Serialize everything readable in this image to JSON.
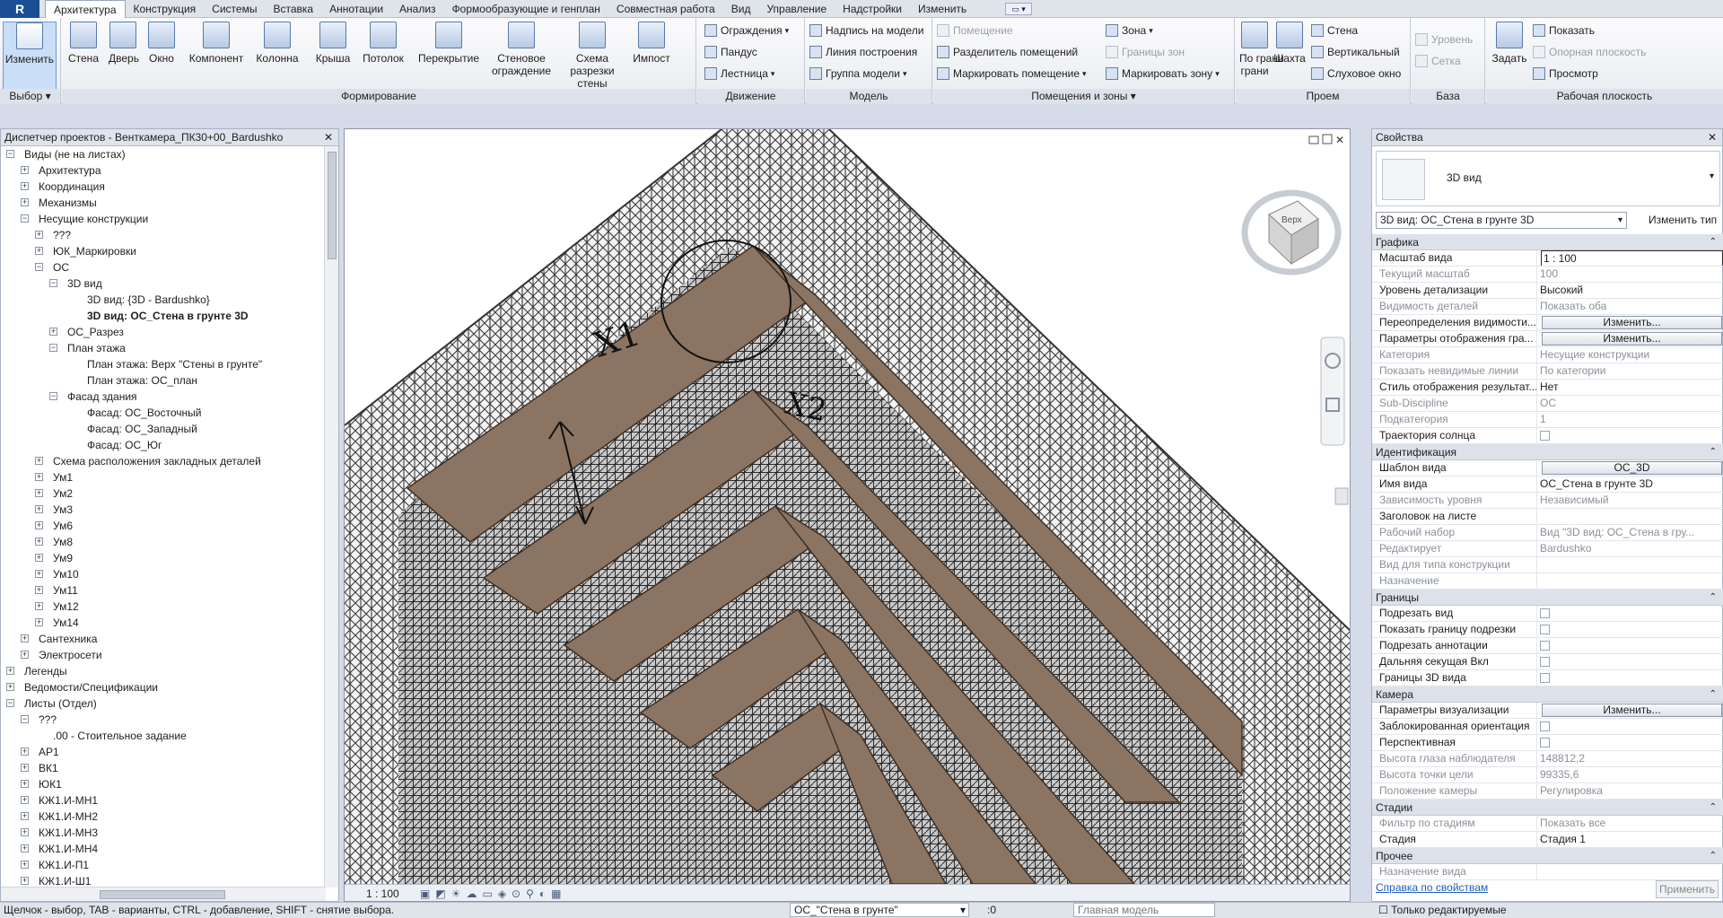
{
  "ribbon": {
    "tabs": [
      "Архитектура",
      "Конструкция",
      "Системы",
      "Вставка",
      "Аннотации",
      "Анализ",
      "Формообразующие и генплан",
      "Совместная работа",
      "Вид",
      "Управление",
      "Надстройки",
      "Изменить"
    ],
    "select": {
      "button": "Изменить",
      "panel": "Выбор"
    },
    "build": {
      "panel": "Формирование",
      "buttons": [
        "Стена",
        "Дверь",
        "Окно",
        "Компонент",
        "Колонна",
        "Крыша",
        "Потолок",
        "Перекрытие",
        "Стеновое ограждение",
        "Схема разрезки стены",
        "Импост"
      ]
    },
    "circulation": {
      "panel": "Движение",
      "items": [
        "Ограждения",
        "Пандус",
        "Лестница"
      ]
    },
    "model": {
      "panel": "Модель",
      "items": [
        "Надпись на модели",
        "Линия построения",
        "Группа модели"
      ]
    },
    "rooms": {
      "panel": "Помещения и зоны",
      "items": [
        "Помещение",
        "Разделитель помещений",
        "Маркировать помещение",
        "Зона",
        "Границы зон",
        "Маркировать зону"
      ]
    },
    "opening": {
      "panel": "Проем",
      "buttons": [
        "По грани",
        "Шахта"
      ],
      "items": [
        "Стена",
        "Вертикальный",
        "Слуховое окно"
      ]
    },
    "datum": {
      "panel": "База",
      "items": [
        "Уровень",
        "Сетка"
      ]
    },
    "workplane": {
      "panel": "Рабочая плоскость",
      "button": "Задать",
      "items": [
        "Показать",
        "Опорная плоскость",
        "Просмотр"
      ]
    }
  },
  "browser": {
    "title": "Диспетчер проектов - Венткамера_ПК30+00_Bardushko",
    "nodes": [
      {
        "t": "Виды (не на листах)",
        "d": 0,
        "g": "-"
      },
      {
        "t": "Архитектура",
        "d": 1,
        "g": "+"
      },
      {
        "t": "Координация",
        "d": 1,
        "g": "+"
      },
      {
        "t": "Механизмы",
        "d": 1,
        "g": "+"
      },
      {
        "t": "Несущие конструкции",
        "d": 1,
        "g": "-"
      },
      {
        "t": "???",
        "d": 2,
        "g": "+"
      },
      {
        "t": "ЮК_Маркировки",
        "d": 2,
        "g": "+"
      },
      {
        "t": "ОС",
        "d": 2,
        "g": "-"
      },
      {
        "t": "3D вид",
        "d": 3,
        "g": "-"
      },
      {
        "t": "3D вид: {3D - Bardushko}",
        "d": 4,
        "g": ""
      },
      {
        "t": "3D вид: ОС_Стена в грунте 3D",
        "d": 4,
        "g": "",
        "b": true
      },
      {
        "t": "ОС_Разрез",
        "d": 3,
        "g": "+"
      },
      {
        "t": "План этажа",
        "d": 3,
        "g": "-"
      },
      {
        "t": "План этажа: Верх \"Стены в грунте\"",
        "d": 4,
        "g": ""
      },
      {
        "t": "План этажа: ОС_план",
        "d": 4,
        "g": ""
      },
      {
        "t": "Фасад здания",
        "d": 3,
        "g": "-"
      },
      {
        "t": "Фасад: ОС_Восточный",
        "d": 4,
        "g": ""
      },
      {
        "t": "Фасад: ОС_Западный",
        "d": 4,
        "g": ""
      },
      {
        "t": "Фасад: ОС_Юг",
        "d": 4,
        "g": ""
      },
      {
        "t": "Схема расположения закладных деталей",
        "d": 2,
        "g": "+"
      },
      {
        "t": "Ум1",
        "d": 2,
        "g": "+"
      },
      {
        "t": "Ум2",
        "d": 2,
        "g": "+"
      },
      {
        "t": "Ум3",
        "d": 2,
        "g": "+"
      },
      {
        "t": "Ум6",
        "d": 2,
        "g": "+"
      },
      {
        "t": "Ум8",
        "d": 2,
        "g": "+"
      },
      {
        "t": "Ум9",
        "d": 2,
        "g": "+"
      },
      {
        "t": "Ум10",
        "d": 2,
        "g": "+"
      },
      {
        "t": "Ум11",
        "d": 2,
        "g": "+"
      },
      {
        "t": "Ум12",
        "d": 2,
        "g": "+"
      },
      {
        "t": "Ум14",
        "d": 2,
        "g": "+"
      },
      {
        "t": "Сантехника",
        "d": 1,
        "g": "+"
      },
      {
        "t": "Электросети",
        "d": 1,
        "g": "+"
      },
      {
        "t": "Легенды",
        "d": 0,
        "g": "+"
      },
      {
        "t": "Ведомости/Спецификации",
        "d": 0,
        "g": "+"
      },
      {
        "t": "Листы (Отдел)",
        "d": 0,
        "g": "-"
      },
      {
        "t": "???",
        "d": 1,
        "g": "-"
      },
      {
        "t": ".00 - Стоительное задание",
        "d": 2,
        "g": ""
      },
      {
        "t": "АР1",
        "d": 1,
        "g": "+"
      },
      {
        "t": "ВК1",
        "d": 1,
        "g": "+"
      },
      {
        "t": "ЮК1",
        "d": 1,
        "g": "+"
      },
      {
        "t": "КЖ1.И-МН1",
        "d": 1,
        "g": "+"
      },
      {
        "t": "КЖ1.И-МН2",
        "d": 1,
        "g": "+"
      },
      {
        "t": "КЖ1.И-МН3",
        "d": 1,
        "g": "+"
      },
      {
        "t": "КЖ1.И-МН4",
        "d": 1,
        "g": "+"
      },
      {
        "t": "КЖ1.И-П1",
        "d": 1,
        "g": "+"
      },
      {
        "t": "КЖ1.И-Ш1",
        "d": 1,
        "g": "+"
      }
    ]
  },
  "viewport": {
    "annot1": "X1",
    "annot2": "X2",
    "viewcube": "Верх",
    "scale": "1 : 100"
  },
  "properties": {
    "title": "Свойства",
    "type": "3D вид",
    "view": "3D вид: ОС_Стена в грунте 3D",
    "edit_type": "Изменить тип",
    "groups": [
      {
        "name": "Графика",
        "rows": [
          [
            "Масштаб вида",
            "1 : 100",
            "inp"
          ],
          [
            "Текущий масштаб",
            "100",
            "dim"
          ],
          [
            "Уровень детализации",
            "Высокий",
            ""
          ],
          [
            "Видимость деталей",
            "Показать оба",
            "dim"
          ],
          [
            "Переопределения видимости...",
            "Изменить...",
            "btn"
          ],
          [
            "Параметры отображения гра...",
            "Изменить...",
            "btn"
          ],
          [
            "Категория",
            "Несущие конструкции",
            "dim"
          ],
          [
            "Показать невидимые линии",
            "По категории",
            "dim"
          ],
          [
            "Стиль отображения результат...",
            "Нет",
            ""
          ],
          [
            "Sub-Discipline",
            "ОС",
            "dim"
          ],
          [
            "Подкатегория",
            "1",
            "dim"
          ],
          [
            "Траектория солнца",
            "",
            "chk"
          ]
        ]
      },
      {
        "name": "Идентификация",
        "rows": [
          [
            "Шаблон вида",
            "ОС_3D",
            "btn"
          ],
          [
            "Имя вида",
            "ОС_Стена в грунте 3D",
            ""
          ],
          [
            "Зависимость уровня",
            "Независимый",
            "dim"
          ],
          [
            "Заголовок на листе",
            "",
            ""
          ],
          [
            "Рабочий набор",
            "Вид \"3D вид: ОС_Стена в гру...",
            "dim"
          ],
          [
            "Редактирует",
            "Bardushko",
            "dim"
          ],
          [
            "Вид для типа конструкции",
            "",
            "dim"
          ],
          [
            "Назначение",
            "",
            "dim"
          ]
        ]
      },
      {
        "name": "Границы",
        "rows": [
          [
            "Подрезать вид",
            "",
            "chk"
          ],
          [
            "Показать границу подрезки",
            "",
            "chk"
          ],
          [
            "Подрезать аннотации",
            "",
            "chk"
          ],
          [
            "Дальняя секущая Вкл",
            "",
            "chk"
          ],
          [
            "Границы 3D вида",
            "",
            "chk"
          ]
        ]
      },
      {
        "name": "Камера",
        "rows": [
          [
            "Параметры визуализации",
            "Изменить...",
            "btn"
          ],
          [
            "Заблокированная ориентация",
            "",
            "chk"
          ],
          [
            "Перспективная",
            "",
            "chk"
          ],
          [
            "Высота глаза наблюдателя",
            "148812,2",
            "dim"
          ],
          [
            "Высота точки цели",
            "99335,6",
            "dim"
          ],
          [
            "Положение камеры",
            "Регулировка",
            "dim"
          ]
        ]
      },
      {
        "name": "Стадии",
        "rows": [
          [
            "Фильтр по стадиям",
            "Показать все",
            "dim"
          ],
          [
            "Стадия",
            "Стадия 1",
            ""
          ]
        ]
      },
      {
        "name": "Прочее",
        "rows": [
          [
            "Назначение вида",
            "",
            "dim"
          ]
        ]
      }
    ],
    "help_link": "Справка по свойствам",
    "apply": "Применить"
  },
  "status": {
    "hint": "Щелчок - выбор, TAB - варианты, CTRL - добавление, SHIFT - снятие выбора.",
    "view_name": "ОС_\"Стена в грунте\"",
    "model": "Главная модель",
    "editable_only": "Только редактируемые",
    "zero": ":0"
  }
}
